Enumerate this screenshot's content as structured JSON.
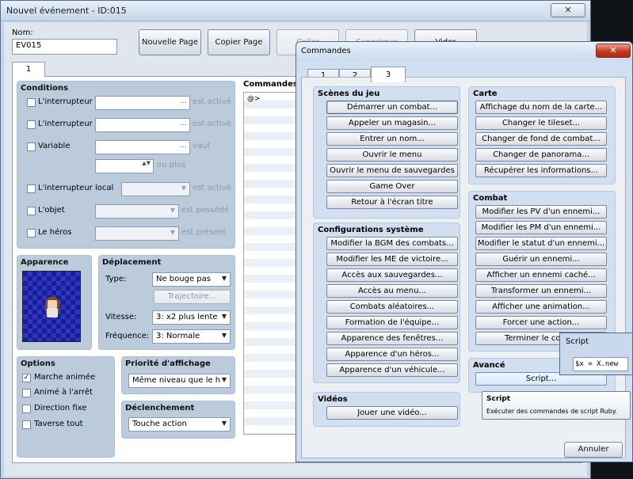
{
  "main_window": {
    "title": "Nouvel événement - ID:015",
    "close_glyph": "✕",
    "name_label": "Nom:",
    "name_value": "EV015",
    "buttons": {
      "new_page": "Nouvelle Page",
      "copy_page": "Copier Page",
      "paste": "Coller",
      "delete": "Supprimer",
      "clear": "Vider"
    },
    "page_tab": "1",
    "conditions": {
      "title": "Conditions",
      "switch1_label": "L'interrupteur",
      "switch1_suffix": "est activé",
      "switch2_label": "L'interrupteur",
      "switch2_suffix": "est activé",
      "variable_label": "Variable",
      "variable_suffix": "vaut",
      "or_more": "ou plus",
      "local_switch_label": "L'interrupteur local",
      "local_switch_suffix": "est activé",
      "item_label": "L'objet",
      "item_suffix": "est possédé",
      "actor_label": "Le héros",
      "actor_suffix": "est présent",
      "ellipsis": "..."
    },
    "appearance": {
      "title": "Apparence"
    },
    "movement": {
      "title": "Déplacement",
      "type_label": "Type:",
      "type_value": "Ne bouge pas",
      "route_button": "Trajectoire...",
      "speed_label": "Vitesse:",
      "speed_value": "3: x2 plus lente",
      "freq_label": "Fréquence:",
      "freq_value": "3: Normale"
    },
    "options": {
      "title": "Options",
      "items": [
        {
          "label": "Marche animée",
          "checked": true
        },
        {
          "label": "Animé à l'arrêt",
          "checked": false
        },
        {
          "label": "Direction fixe",
          "checked": false
        },
        {
          "label": "Taverse tout",
          "checked": false
        }
      ]
    },
    "priority": {
      "title": "Priorité d'affichage",
      "value": "Même niveau que le h"
    },
    "trigger": {
      "title": "Déclenchement",
      "value": "Touche action"
    },
    "commands": {
      "title": "Commandes",
      "first_line": "@>"
    }
  },
  "command_dialog": {
    "title": "Commandes",
    "close_glyph": "✕",
    "tabs": [
      "1",
      "2",
      "3"
    ],
    "active_tab": "3",
    "groups": {
      "scenes": {
        "title": "Scènes du jeu",
        "items": [
          "Démarrer un combat...",
          "Appeler un magasin...",
          "Entrer un nom...",
          "Ouvrir le menu",
          "Ouvrir le menu de sauvegardes",
          "Game Over",
          "Retour à l'écran titre"
        ]
      },
      "system": {
        "title": "Configurations système",
        "items": [
          "Modifier la BGM des combats...",
          "Modifier les ME de victoire...",
          "Accès aux sauvegardes...",
          "Accès au menu...",
          "Combats aléatoires...",
          "Formation de l'équipe...",
          "Apparence des fenêtres...",
          "Apparence d'un héros...",
          "Apparence d'un véhicule..."
        ]
      },
      "videos": {
        "title": "Vidéos",
        "items": [
          "Jouer une vidéo..."
        ]
      },
      "map": {
        "title": "Carte",
        "items": [
          "Affichage du nom de la carte...",
          "Changer le tileset...",
          "Changer de fond de combat...",
          "Changer de panorama...",
          "Récupérer les informations..."
        ]
      },
      "battle": {
        "title": "Combat",
        "items": [
          "Modifier les PV d'un ennemi...",
          "Modifier les PM d'un ennemi...",
          "Modifier le statut d'un ennemi...",
          "Guérir un ennemi...",
          "Afficher un ennemi caché...",
          "Transformer un ennemi...",
          "Afficher une animation...",
          "Forcer une action...",
          "Terminer le co"
        ]
      },
      "advanced": {
        "title": "Avancé",
        "items": [
          "Script..."
        ]
      }
    },
    "cancel_button": "Annuler"
  },
  "script_popup": {
    "title": "Script",
    "code": "$x = X.new"
  },
  "tooltip": {
    "title": "Script",
    "text": "Exécuter des commandes de script Ruby."
  }
}
